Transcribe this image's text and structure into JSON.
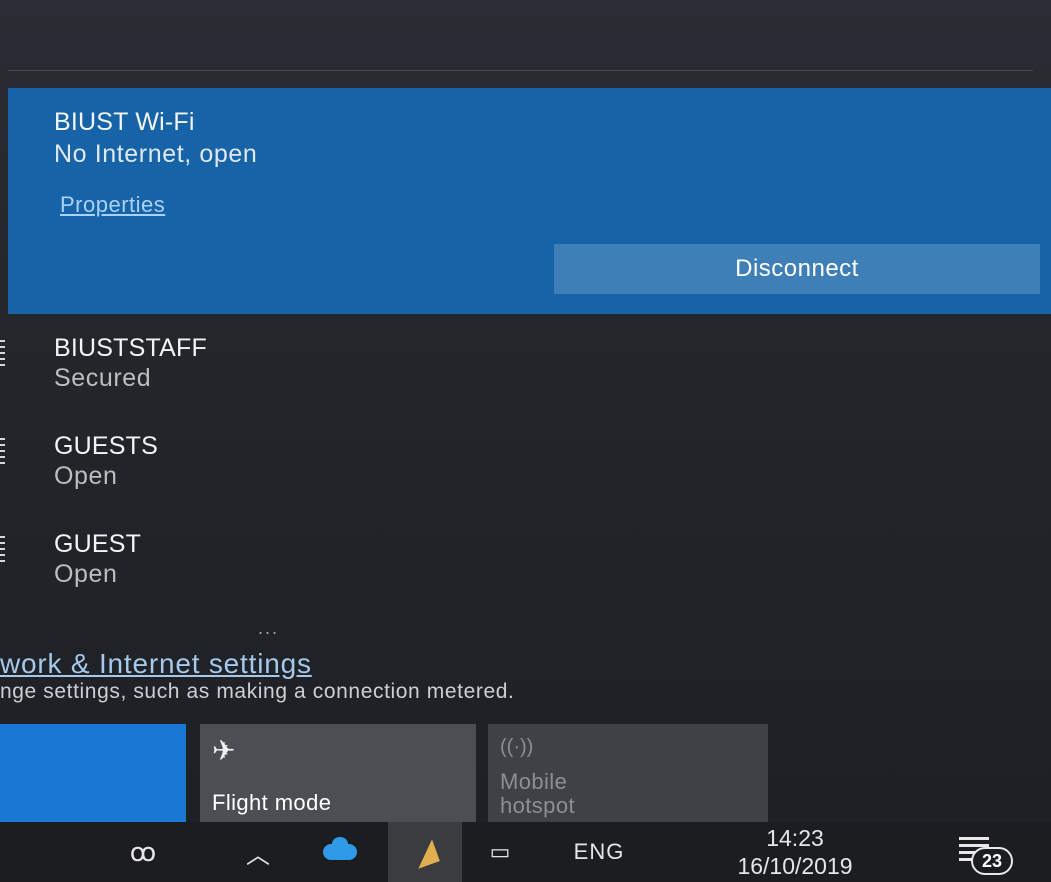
{
  "networks": {
    "connected": {
      "name": "BIUST Wi-Fi",
      "status": "No Internet, open",
      "properties_label": "Properties",
      "disconnect_label": "Disconnect"
    },
    "available": [
      {
        "name": "BIUSTSTAFF",
        "status": "Secured"
      },
      {
        "name": "GUESTS",
        "status": "Open"
      },
      {
        "name": "GUEST",
        "status": "Open"
      }
    ],
    "more_indicator": "..."
  },
  "settings": {
    "link_label": "work & Internet settings",
    "description": "nge settings, such as making a connection metered."
  },
  "quick_actions": {
    "flight_mode_label": "Flight mode",
    "mobile_hotspot_label": "Mobile hotspot"
  },
  "taskbar": {
    "language": "ENG",
    "time": "14:23",
    "date": "16/10/2019",
    "notification_count": "23"
  },
  "colors": {
    "accent": "#1664a7",
    "button": "#3f7fb8",
    "wifi_tile": "#1a78d4",
    "link": "#a9d0f5"
  },
  "icons": {
    "people": "people-icon",
    "chevron": "chevron-up-icon",
    "cloud": "onedrive-cloud-icon",
    "wifi": "wifi-no-internet-icon",
    "battery": "battery-icon",
    "notifications": "action-center-icon",
    "airplane": "airplane-icon",
    "hotspot": "mobile-hotspot-icon"
  }
}
